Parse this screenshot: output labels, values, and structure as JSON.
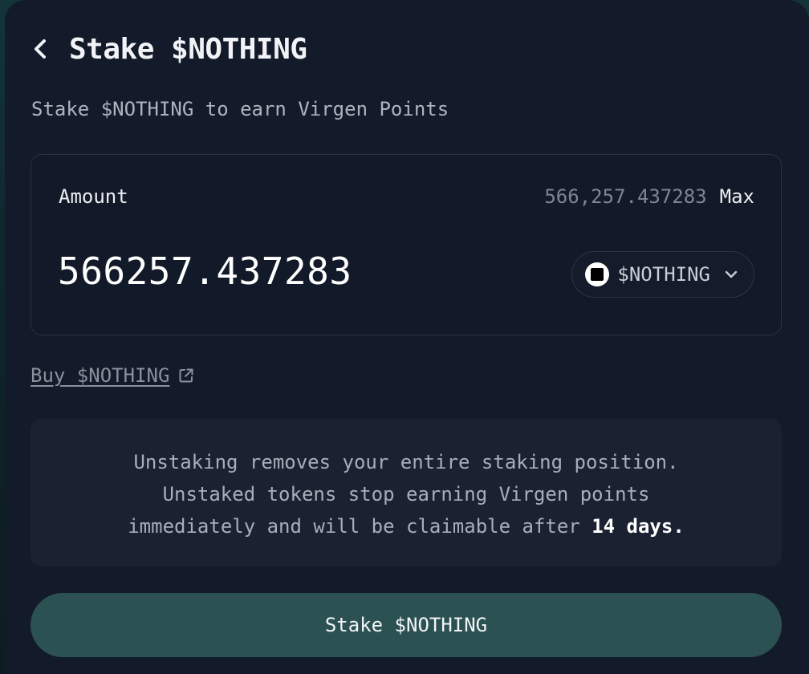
{
  "header": {
    "title": "Stake $NOTHING"
  },
  "subtitle": "Stake $NOTHING to earn Virgen Points",
  "amount_card": {
    "label": "Amount",
    "balance": "566,257.437283",
    "max_label": "Max",
    "input_value": "566257.437283",
    "token": {
      "name": "$NOTHING",
      "icon": "nothing-token-icon"
    }
  },
  "buy_link": {
    "label": "Buy $NOTHING",
    "icon": "external-link-icon"
  },
  "info": {
    "line1": "Unstaking removes your entire staking position.",
    "line2": "Unstaked tokens stop earning Virgen points",
    "line3_prefix": "immediately and will be claimable after ",
    "line3_emphasis": "14 days."
  },
  "stake_button": {
    "label": "Stake $NOTHING"
  },
  "colors": {
    "background": "#131a29",
    "card_border": "#2a3243",
    "info_bg": "#1a2131",
    "button_bg": "#2c5152",
    "muted_text": "#8a919d"
  }
}
